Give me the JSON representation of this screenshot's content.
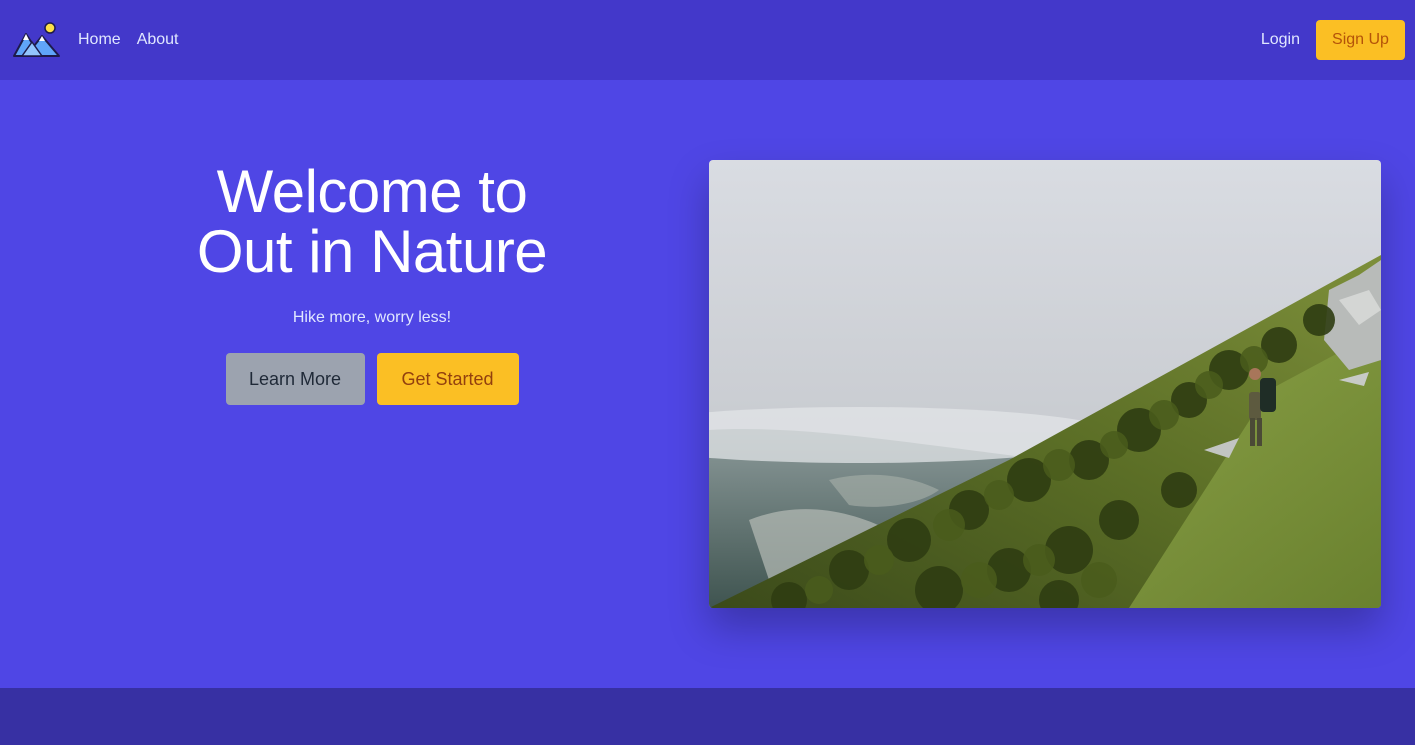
{
  "nav": {
    "logo_icon": "mountain-sun-logo-icon",
    "links": [
      "Home",
      "About"
    ],
    "login": "Login",
    "signup": "Sign Up"
  },
  "hero": {
    "title_line1": "Welcome to",
    "title_line2": "Out in Nature",
    "subtitle": "Hike more, worry less!",
    "learn_more": "Learn More",
    "get_started": "Get Started",
    "image_icon": "hiker-on-misty-mountain-slope-photo"
  },
  "colors": {
    "nav_bg": "#4338ca",
    "hero_bg": "#4f46e5",
    "footer_bg": "#3730a3",
    "accent": "#fbbf24",
    "secondary_button": "#9ca3af"
  }
}
